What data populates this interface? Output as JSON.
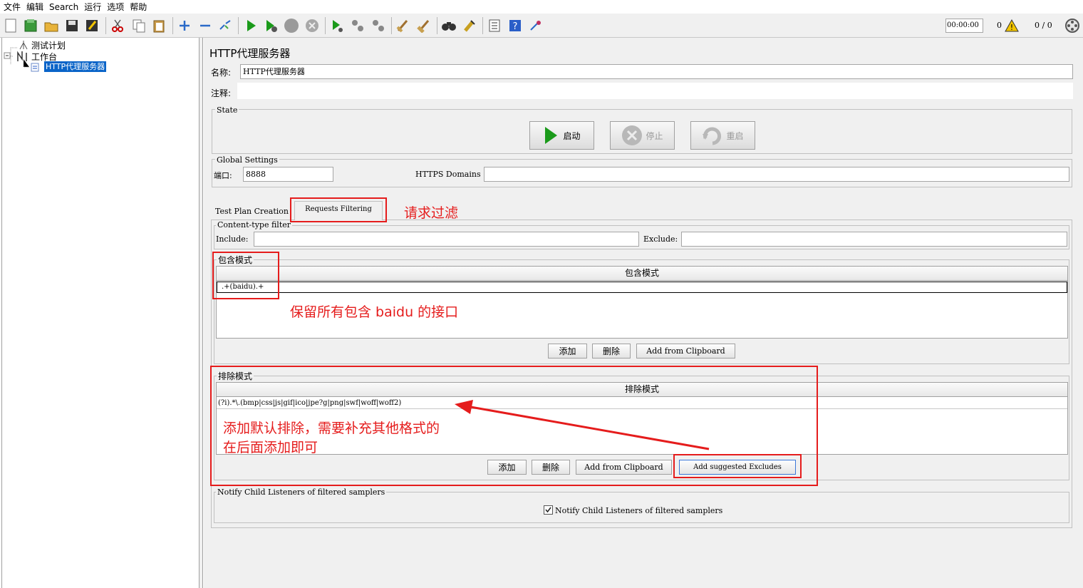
{
  "menu": [
    "文件",
    "编辑",
    "Search",
    "运行",
    "选项",
    "帮助"
  ],
  "toolbar": {
    "timer": "00:00:00",
    "warn_count": "0",
    "threads": "0 / 0"
  },
  "tree": {
    "items": [
      "测试计划",
      "工作台",
      "HTTP代理服务器"
    ]
  },
  "panel": {
    "title": "HTTP代理服务器",
    "name_label": "名称:",
    "name_value": "HTTP代理服务器",
    "comment_label": "注释:",
    "comment_value": ""
  },
  "state": {
    "legend": "State",
    "start": "启动",
    "stop": "停止",
    "restart": "重启"
  },
  "global": {
    "legend": "Global Settings",
    "port_label": "端口:",
    "port_value": "8888",
    "https_label": "HTTPS Domains :",
    "https_value": ""
  },
  "tabs": [
    "Test Plan Creation",
    "Requests Filtering"
  ],
  "content_filter": {
    "legend": "Content-type filter",
    "include_label": "Include:",
    "include_value": "",
    "exclude_label": "Exclude:",
    "exclude_value": ""
  },
  "include_patterns": {
    "legend": "包含模式",
    "header": "包含模式",
    "rows": [
      ".+(baidu).+"
    ],
    "add": "添加",
    "delete": "删除",
    "clipboard": "Add from Clipboard"
  },
  "exclude_patterns": {
    "legend": "排除模式",
    "header": "排除模式",
    "rows": [
      "(?i).*\\.(bmp|css|js|gif|ico|jpe?g|png|swf|woff|woff2)"
    ],
    "add": "添加",
    "delete": "删除",
    "clipboard": "Add from Clipboard",
    "suggested": "Add suggested Excludes"
  },
  "notify": {
    "legend": "Notify Child Listeners of filtered samplers",
    "checkbox_label": "Notify Child Listeners of filtered samplers",
    "checked": true
  },
  "annotations": {
    "filter": "请求过滤",
    "include_note": "保留所有包含 baidu 的接口",
    "exclude_note_line1": "添加默认排除，需要补充其他格式的",
    "exclude_note_line2": "在后面添加即可"
  },
  "colors": {
    "annotation": "#e51c1c",
    "selection": "#0a64c8",
    "background": "#f0f0f0"
  }
}
